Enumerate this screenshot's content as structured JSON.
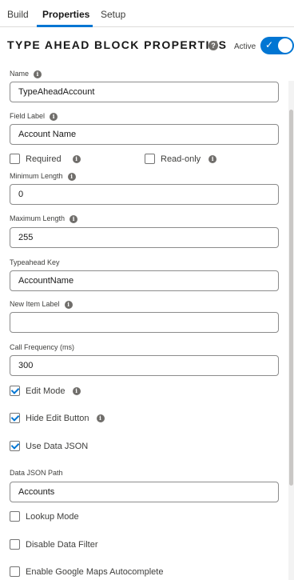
{
  "tabs": [
    {
      "label": "Build"
    },
    {
      "label": "Properties"
    },
    {
      "label": "Setup"
    }
  ],
  "header": {
    "title": "TYPE AHEAD BLOCK PROPERTIES",
    "help_glyph": "?",
    "active_label": "Active",
    "active_on": true
  },
  "info_glyph": "i",
  "fields": {
    "name": {
      "label": "Name",
      "value": "TypeAheadAccount"
    },
    "field_label": {
      "label": "Field Label",
      "value": "Account Name"
    },
    "required": {
      "label": "Required",
      "checked": false
    },
    "read_only": {
      "label": "Read-only",
      "checked": false
    },
    "min_length": {
      "label": "Minimum Length",
      "value": "0"
    },
    "max_length": {
      "label": "Maximum Length",
      "value": "255"
    },
    "typeahead_key": {
      "label": "Typeahead Key",
      "value": "AccountName"
    },
    "new_item_label": {
      "label": "New Item Label",
      "value": ""
    },
    "call_frequency": {
      "label": "Call Frequency (ms)",
      "value": "300"
    },
    "edit_mode": {
      "label": "Edit Mode",
      "checked": true
    },
    "hide_edit_button": {
      "label": "Hide Edit Button",
      "checked": true
    },
    "use_data_json": {
      "label": "Use Data JSON",
      "checked": true
    },
    "data_json_path": {
      "label": "Data JSON Path",
      "value": "Accounts"
    },
    "lookup_mode": {
      "label": "Lookup Mode",
      "checked": false
    },
    "disable_data_filter": {
      "label": "Disable Data Filter",
      "checked": false
    },
    "google_maps": {
      "label": "Enable Google Maps Autocomplete",
      "checked": false
    }
  },
  "colors": {
    "accent": "#0176d3",
    "border": "#8c8c8c",
    "text": "#3e3e3c"
  }
}
